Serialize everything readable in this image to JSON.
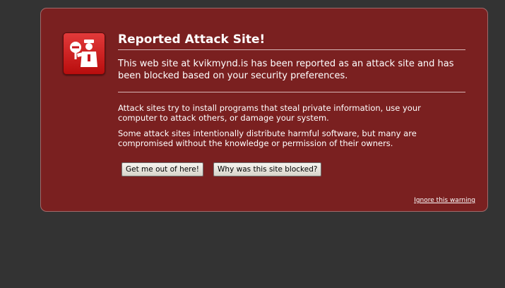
{
  "window": {
    "title": "Reported Attack Site!"
  },
  "icon": {
    "name": "security-officer-stop-icon",
    "color": "#c8161d"
  },
  "warning": {
    "title": "Reported Attack Site!",
    "intro": "This web site at kvikmynd.is has been reported as an attack site and has been blocked based on your security preferences.",
    "details": [
      "Attack sites try to install programs that steal private information, use your computer to attack others, or damage your system.",
      "Some attack sites intentionally distribute harmful software, but many are compromised without the knowledge or permission of their owners."
    ],
    "buttons": {
      "get_out": "Get me out of here!",
      "why_blocked": "Why was this site blocked?"
    },
    "ignore_link": "Ignore this warning"
  },
  "colors": {
    "page_background": "#333333",
    "panel_background": "#7a2020",
    "text": "#ffffff"
  }
}
